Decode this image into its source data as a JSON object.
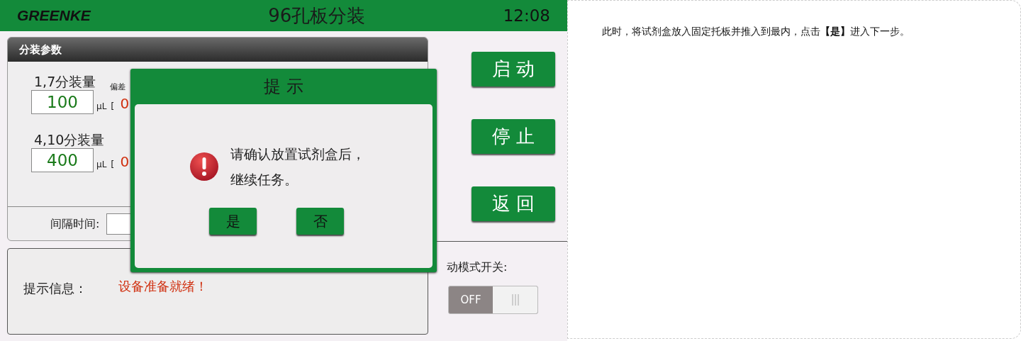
{
  "header": {
    "logo": "GREENKE",
    "title": "96孔板分装",
    "time": "12:08"
  },
  "params_panel": {
    "title": "分装参数",
    "deviation_label": "偏差",
    "fields": [
      {
        "label": "1,7分装量",
        "value": "100",
        "unit": "μL",
        "bracket": "[",
        "deviation": "0"
      },
      {
        "label": "4,10分装量",
        "value": "400",
        "unit": "μL",
        "bracket": "[",
        "deviation": "0"
      }
    ],
    "interval_label": "间隔时间:"
  },
  "buttons": [
    "启 动",
    "停 止",
    "返 回"
  ],
  "info": {
    "label": "提示信息：",
    "message": "设备准备就绪！"
  },
  "mode_switch": {
    "label": "动模式开关:",
    "on": false,
    "off_text": "OFF"
  },
  "dialog": {
    "title": "提 示",
    "message_lines": [
      "请确认放置试剂盒后，",
      "继续任务。"
    ],
    "buttons": [
      "是",
      "否"
    ]
  },
  "note": "此时，将试剂盒放入固定托板并推入到最内，点击**【是】**进入下一步。"
}
